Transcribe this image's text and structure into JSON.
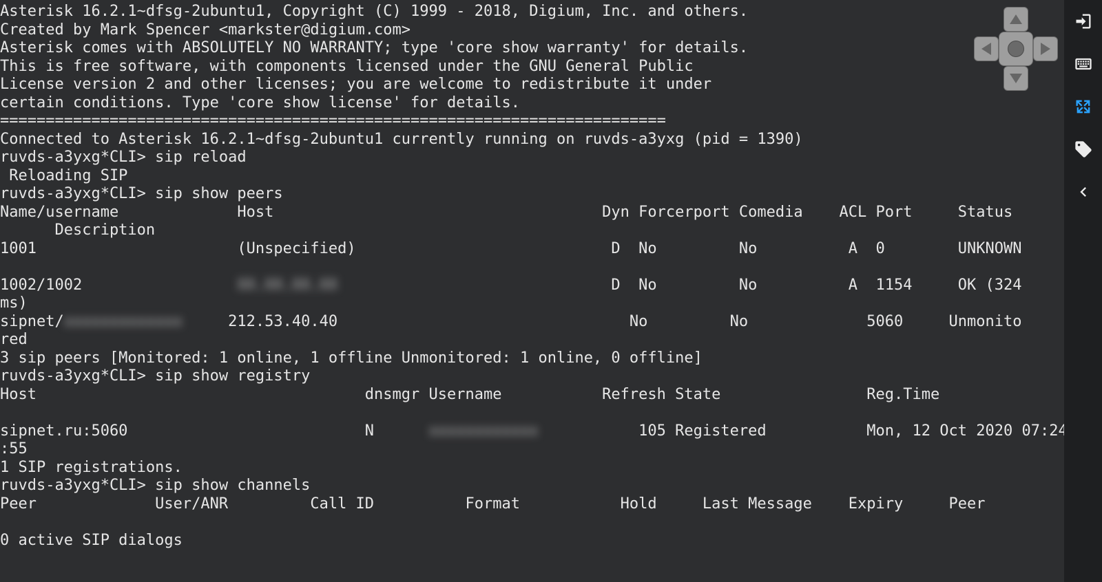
{
  "terminal": {
    "l01": "Asterisk 16.2.1~dfsg-2ubuntu1, Copyright (C) 1999 - 2018, Digium, Inc. and others.",
    "l02": "Created by Mark Spencer <markster@digium.com>",
    "l03": "Asterisk comes with ABSOLUTELY NO WARRANTY; type 'core show warranty' for details.",
    "l04": "This is free software, with components licensed under the GNU General Public",
    "l05": "License version 2 and other licenses; you are welcome to redistribute it under",
    "l06": "certain conditions. Type 'core show license' for details.",
    "l07": "=========================================================================",
    "l08": "Connected to Asterisk 16.2.1~dfsg-2ubuntu1 currently running on ruvds-a3yxg (pid = 1390)",
    "l09": "ruvds-a3yxg*CLI> sip reload",
    "l10": " Reloading SIP",
    "l11": "ruvds-a3yxg*CLI> sip show peers",
    "l12": "Name/username             Host                                    Dyn Forcerport Comedia    ACL Port     Status",
    "l13": "      Description",
    "l14": "1001                      (Unspecified)                            D  No         No          A  0        UNKNOWN",
    "l15": "",
    "l16a": "1002/1002                 ",
    "l16b": "XX.XX.XX.XX",
    "l16c": "                              D  No         No          A  1154     OK (324 ",
    "l17": "ms)",
    "l18a": "sipnet/",
    "l18b": "xxxxxxxxxxxxx",
    "l18c": "     212.53.40.40                                No         No             5060     Unmonito",
    "l19": "red",
    "l20": "3 sip peers [Monitored: 1 online, 1 offline Unmonitored: 1 online, 0 offline]",
    "l21": "ruvds-a3yxg*CLI> sip show registry",
    "l22": "Host                                    dnsmgr Username           Refresh State                Reg.Time",
    "l23": "",
    "l24a": "sipnet.ru:5060                          N      ",
    "l24b": "xxxxxxxxxxxx",
    "l24c": "           105 Registered           Mon, 12 Oct 2020 07:24",
    "l25": ":55",
    "l26": "1 SIP registrations.",
    "l27": "ruvds-a3yxg*CLI> sip show channels",
    "l28": "Peer             User/ANR         Call ID          Format           Hold     Last Message    Expiry     Peer",
    "l29": "",
    "l30": "0 active SIP dialogs"
  },
  "toolbar": {
    "exit": "exit",
    "keyboard": "keyboard",
    "fullscreen": "fullscreen",
    "tag": "tag",
    "back": "back"
  },
  "dpad": {
    "up": "up",
    "down": "down",
    "left": "left",
    "right": "right",
    "center": "center"
  }
}
